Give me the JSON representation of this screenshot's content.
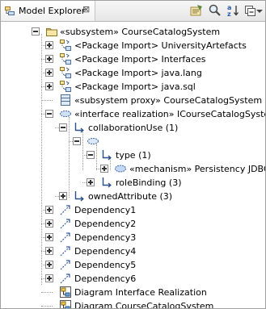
{
  "view": {
    "title": "Model Explorer",
    "close_glyph": "⊠",
    "toolbar": [
      "link-with-editor-icon",
      "search-icon",
      "sort-alpha-icon",
      "collapse-all-icon",
      "view-menu-icon"
    ]
  },
  "tree": [
    {
      "label": "«subsystem» CourseCatalogSystem",
      "icon": "package-icon",
      "expander": "minus"
    },
    {
      "label": "<Package Import> UniversityArtefacts",
      "icon": "package-import-icon",
      "expander": "plus"
    },
    {
      "label": "<Package Import> Interfaces",
      "icon": "package-import-icon",
      "expander": "plus"
    },
    {
      "label": "<Package Import> java.lang",
      "icon": "package-import-icon",
      "expander": "plus"
    },
    {
      "label": "<Package Import> java.sql",
      "icon": "package-import-icon",
      "expander": "plus"
    },
    {
      "label": "«subsystem proxy» CourseCatalogSystem",
      "icon": "class-icon",
      "expander": "none"
    },
    {
      "label": "«interface realization» ICourseCatalogSystem",
      "icon": "interface-realization-icon",
      "expander": "minus"
    },
    {
      "label": "collaborationUse (1)",
      "icon": "reference-icon",
      "expander": "minus"
    },
    {
      "label": "",
      "icon": "collaboration-use-icon",
      "expander": "minus"
    },
    {
      "label": "type (1)",
      "icon": "reference-icon",
      "expander": "minus"
    },
    {
      "label": "«mechanism» Persistency JDBC",
      "icon": "collaboration-icon",
      "expander": "plus"
    },
    {
      "label": "roleBinding (3)",
      "icon": "reference-icon",
      "expander": "plus"
    },
    {
      "label": "ownedAttribute (3)",
      "icon": "reference-icon",
      "expander": "plus"
    },
    {
      "label": "Dependency1",
      "icon": "dependency-icon",
      "expander": "plus"
    },
    {
      "label": "Dependency2",
      "icon": "dependency-icon",
      "expander": "plus"
    },
    {
      "label": "Dependency3",
      "icon": "dependency-icon",
      "expander": "plus"
    },
    {
      "label": "Dependency4",
      "icon": "dependency-icon",
      "expander": "plus"
    },
    {
      "label": "Dependency5",
      "icon": "dependency-icon",
      "expander": "plus"
    },
    {
      "label": "Dependency6",
      "icon": "dependency-icon",
      "expander": "plus"
    },
    {
      "label": "Diagram Interface Realization",
      "icon": "diagram-icon",
      "expander": "none"
    },
    {
      "label": "Diagram CourseCatalogSystem",
      "icon": "diagram-icon",
      "expander": "none"
    }
  ]
}
